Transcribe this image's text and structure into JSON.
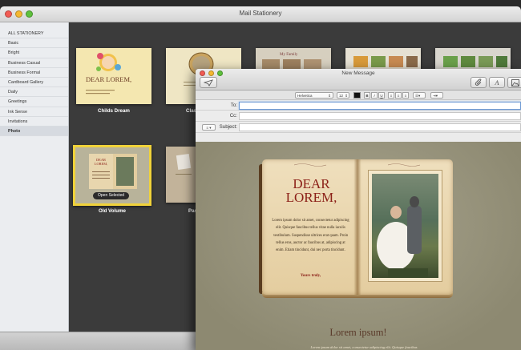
{
  "stationery_window": {
    "title": "Mail Stationery",
    "sidebar": [
      {
        "label": "ALL STATIONERY"
      },
      {
        "label": "Basic"
      },
      {
        "label": "Bright"
      },
      {
        "label": "Business Casual"
      },
      {
        "label": "Business Formal"
      },
      {
        "label": "Cardboard Gallery"
      },
      {
        "label": "Daily"
      },
      {
        "label": "Greetings"
      },
      {
        "label": "Ink Sense"
      },
      {
        "label": "Invitations"
      },
      {
        "label": "Photo",
        "selected": true
      }
    ],
    "templates": [
      {
        "label": "Childs Dream",
        "thumb_title": "DEAR LOREM,"
      },
      {
        "label": "Clas"
      },
      {
        "label": "",
        "thumb_title": "My Family"
      },
      {
        "label": ""
      },
      {
        "label": ""
      },
      {
        "label": "Old Volume",
        "thumb_title": "DEAR LOREM,",
        "selected": true,
        "badge": "Open Selected"
      },
      {
        "label": "Pas"
      }
    ]
  },
  "message_window": {
    "title": "New Message",
    "format_bar": {
      "font": "Helvetica",
      "size": "12",
      "bold": "B",
      "italic": "I",
      "underline": "U"
    },
    "headers": {
      "to_label": "To:",
      "cc_label": "Cc:",
      "subject_label": "Subject:",
      "to_value": "",
      "cc_value": "",
      "subject_value": ""
    },
    "letter": {
      "heading_line1": "DEAR",
      "heading_line2": "LOREM,",
      "body": "Lorem ipsum dolor sit amet, consectetur adipiscing elit. Quisque faucibus tellus vitae nulla iaculis vestibulum. Suspendisse ultrices erat quam. Proin tellus eros, auctor ac faucibus at, adipiscing at enim. Etiam tincidunt, dui nec porta tincidunt.",
      "sign": "Yours truly,",
      "below_title": "Lorem ipsum!",
      "below_text": "Lorem ipsum dolor sit amet, consectetur adipiscing elit. Quisque faucibus"
    }
  }
}
